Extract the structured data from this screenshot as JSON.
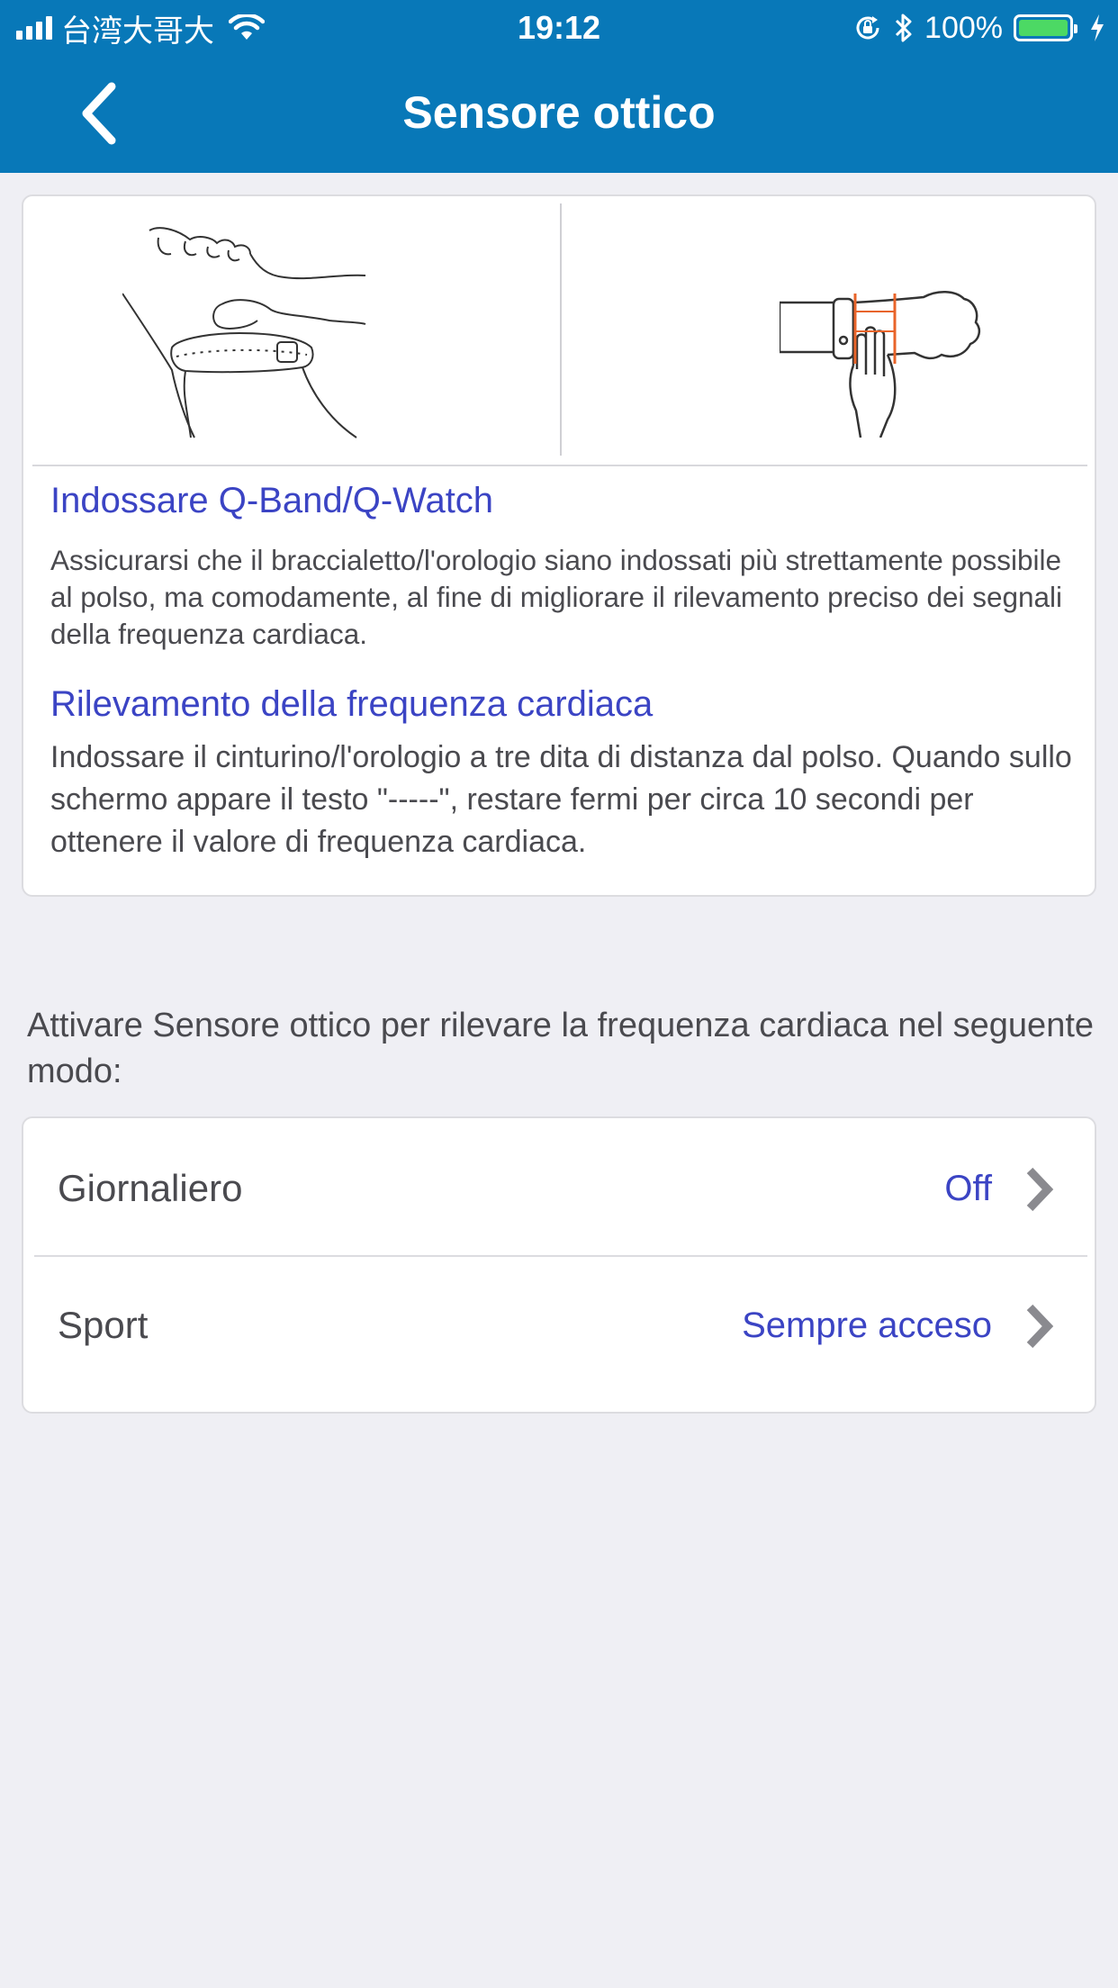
{
  "status_bar": {
    "carrier": "台湾大哥大",
    "time": "19:12",
    "battery_percent": "100%",
    "icons": [
      "signal-icon",
      "wifi-icon",
      "orientation-lock-icon",
      "bluetooth-icon",
      "battery-icon",
      "charging-icon"
    ]
  },
  "header": {
    "title": "Sensore ottico",
    "back_icon": "chevron-left-icon"
  },
  "info": {
    "wear_title": "Indossare Q-Band/Q-Watch",
    "wear_text": "Assicurarsi che il braccialetto/l'orologio siano indossati più strettamente possibile al polso, ma comodamente, al fine di migliorare il rilevamento preciso dei segnali della frequenza cardiaca.",
    "detect_title": "Rilevamento della frequenza cardiaca",
    "detect_text": "Indossare il cinturino/l'orologio a tre dita di distanza dal polso. Quando sullo schermo appare il testo \"-----\", restare fermi per circa 10 secondi per ottenere il valore di frequenza cardiaca."
  },
  "prompt": "Attivare Sensore ottico per rilevare la frequenza cardiaca nel seguente modo:",
  "settings": {
    "rows": [
      {
        "label": "Giornaliero",
        "value": "Off"
      },
      {
        "label": "Sport",
        "value": "Sempre acceso"
      }
    ]
  },
  "colors": {
    "header_bg": "#0878b8",
    "accent_text": "#3b44c4",
    "page_bg": "#efeff4",
    "battery_fill": "#4cd964",
    "illustration_orange": "#e8642a"
  }
}
